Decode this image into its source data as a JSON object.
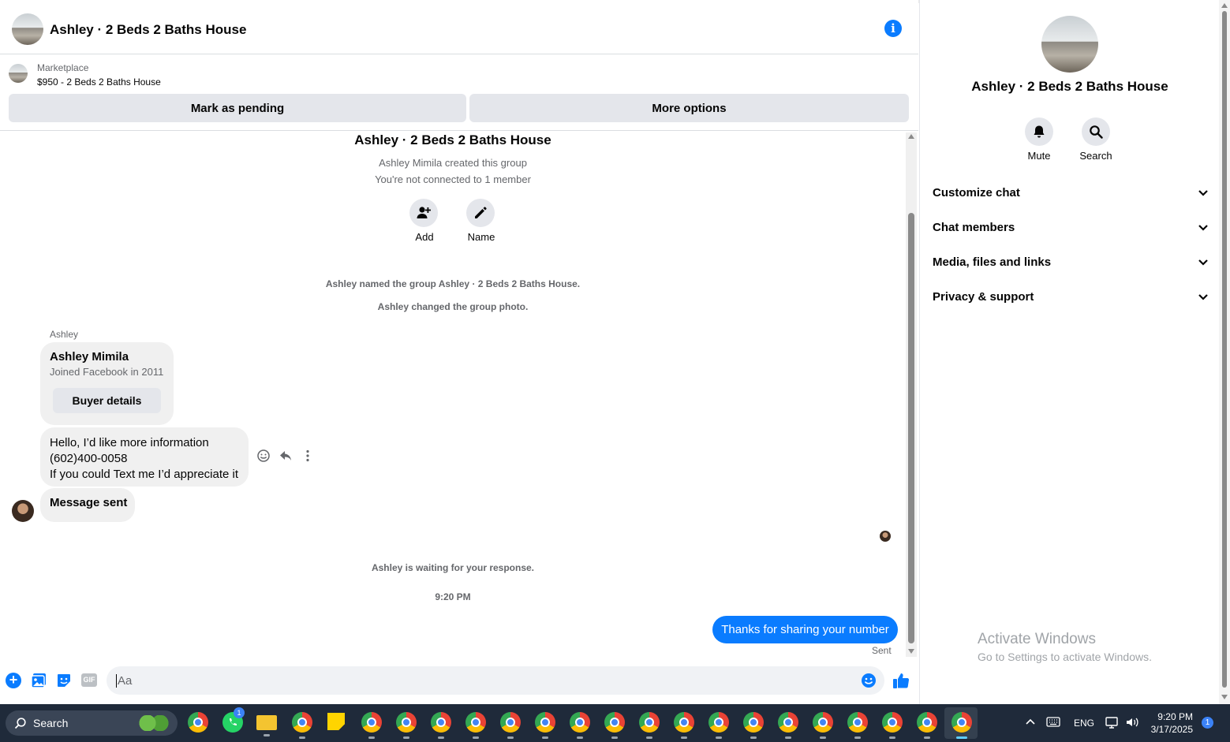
{
  "header": {
    "title": "Ashley · 2 Beds 2 Baths House"
  },
  "listing": {
    "source": "Marketplace",
    "price_title": "$950 - 2 Beds 2 Baths House",
    "mark_pending": "Mark as pending",
    "more_options": "More options"
  },
  "intro": {
    "title": "Ashley · 2 Beds 2 Baths House",
    "created": "Ashley Mimila created this group",
    "not_connected": "You're not connected to 1 member",
    "add_label": "Add",
    "name_label": "Name"
  },
  "events": {
    "named": "Ashley named the group Ashley · 2 Beds 2 Baths House.",
    "photo": "Ashley changed the group photo.",
    "waiting": "Ashley is waiting for your response.",
    "time": "9:20 PM"
  },
  "messages": {
    "sender": "Ashley",
    "profile_name": "Ashley Mimila",
    "profile_joined": "Joined Facebook in 2011",
    "buyer_details": "Buyer details",
    "msg1_line1": "Hello, I’d like more information",
    "msg1_line2": "(602)400-0058",
    "msg1_line3": "If you could Text me I’d appreciate it",
    "msg2": "Message sent",
    "outgoing": "Thanks for sharing your number",
    "outgoing_status": "Sent"
  },
  "composer": {
    "placeholder": "Aa"
  },
  "sidebar": {
    "title": "Ashley · 2 Beds 2 Baths House",
    "mute": "Mute",
    "search": "Search",
    "sections": [
      "Customize chat",
      "Chat members",
      "Media, files and links",
      "Privacy & support"
    ]
  },
  "watermark": {
    "line1": "Activate Windows",
    "line2": "Go to Settings to activate Windows."
  },
  "taskbar": {
    "search": "Search",
    "lang": "ENG",
    "time": "9:20 PM",
    "date": "3/17/2025",
    "notif": "1",
    "whatsapp_badge": "1"
  },
  "colors": {
    "accent": "#0a7cff",
    "bubble": "#f0f0f0",
    "taskbar": "#1f2a3a"
  }
}
